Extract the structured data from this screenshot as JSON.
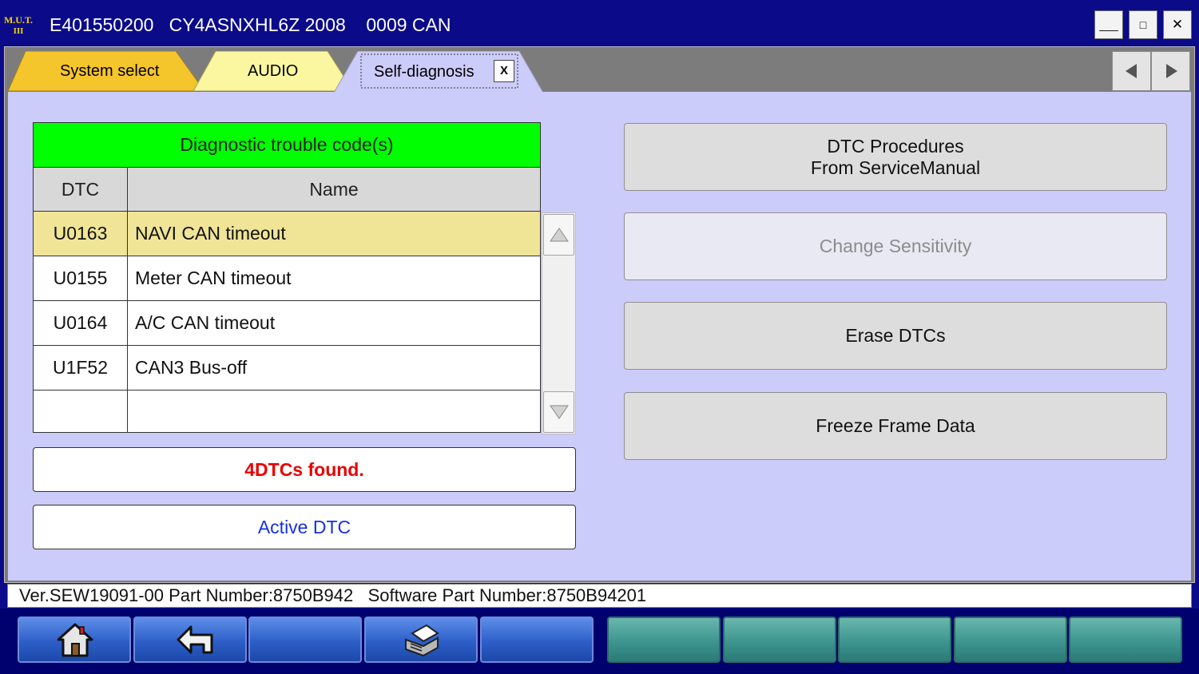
{
  "window": {
    "logo_line1": "M.U.T.",
    "logo_line2": "III",
    "title": "E401550200   CY4ASNXHL6Z 2008    0009 CAN",
    "minimize_glyph": "___",
    "maximize_glyph": "□",
    "close_glyph": "✕"
  },
  "tabs": [
    {
      "label": "System select",
      "color": "#f5c52c"
    },
    {
      "label": "AUDIO",
      "color": "#fbf7a0"
    },
    {
      "label": "Self-diagnosis",
      "color": "#ccccfa",
      "active": true,
      "close_label": "X"
    }
  ],
  "nav": {
    "prev_icon": "triangle-left-icon",
    "next_icon": "triangle-right-icon"
  },
  "dtc_table": {
    "title": "Diagnostic trouble code(s)",
    "columns": [
      "DTC",
      "Name"
    ],
    "rows": [
      {
        "code": "U0163",
        "name": "NAVI CAN timeout",
        "selected": true
      },
      {
        "code": "U0155",
        "name": "Meter CAN timeout"
      },
      {
        "code": "U0164",
        "name": "A/C CAN timeout"
      },
      {
        "code": "U1F52",
        "name": "CAN3 Bus-off"
      },
      {
        "code": "",
        "name": ""
      }
    ]
  },
  "status": {
    "count_text": "4DTCs found.",
    "active_text": "Active DTC"
  },
  "actions": {
    "dtc_procedures_line1": "DTC Procedures",
    "dtc_procedures_line2": "From ServiceManual",
    "change_sensitivity": "Change Sensitivity",
    "erase_dtcs": "Erase DTCs",
    "freeze_frame": "Freeze Frame Data"
  },
  "statusline": {
    "text": "Ver.SEW19091-00 Part Number:8750B942   Software Part Number:8750B94201"
  },
  "toolbar": {
    "buttons": [
      {
        "icon": "home-icon",
        "style": "blue"
      },
      {
        "icon": "back-arrow-icon",
        "style": "blue"
      },
      {
        "icon": "",
        "style": "blue"
      },
      {
        "icon": "printer-icon",
        "style": "blue"
      },
      {
        "icon": "",
        "style": "blue"
      },
      {
        "icon": "",
        "style": "teal"
      },
      {
        "icon": "",
        "style": "teal"
      },
      {
        "icon": "",
        "style": "teal"
      },
      {
        "icon": "",
        "style": "teal"
      },
      {
        "icon": "",
        "style": "teal"
      }
    ]
  },
  "colors": {
    "title_bar": "#0b0b8a",
    "content_bg": "#ccccfa",
    "table_header": "#00ff00",
    "selected_row": "#f0e497",
    "count_text": "#e80000",
    "active_text": "#1730e6"
  }
}
